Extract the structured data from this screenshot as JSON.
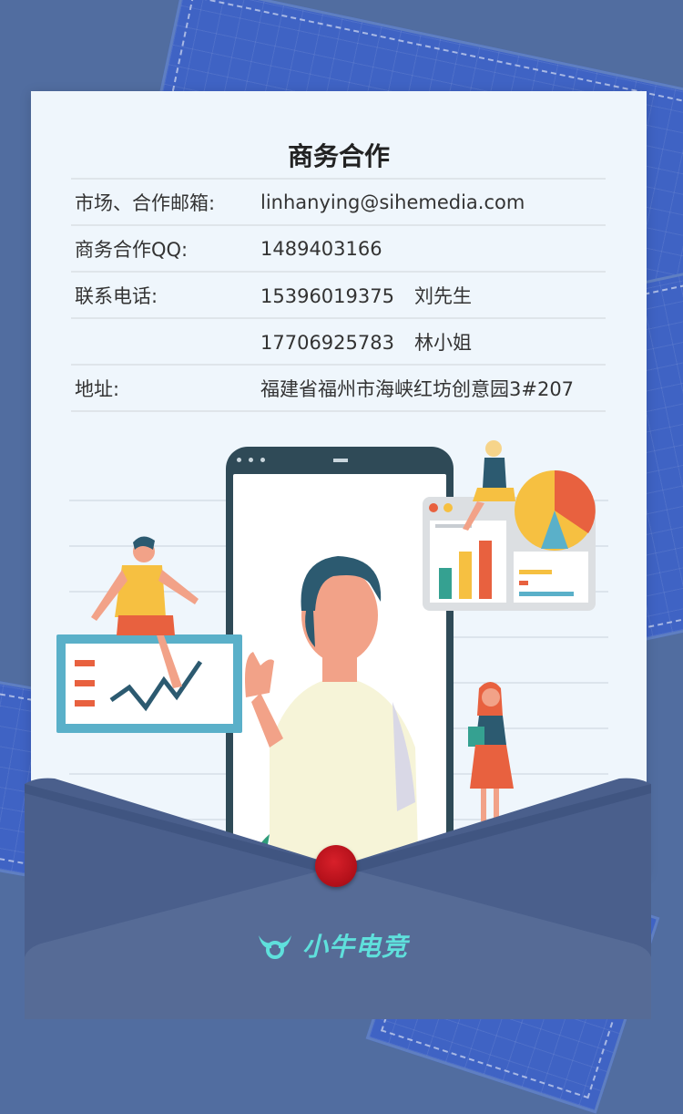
{
  "card": {
    "title": "商务合作",
    "rows": [
      {
        "label": "市场、合作邮箱:",
        "value": "linhanying@sihemedia.com"
      },
      {
        "label": "商务合作QQ:",
        "value": "1489403166"
      },
      {
        "label": "联系电话:",
        "value": "15396019375",
        "person": "刘先生"
      },
      {
        "label": "",
        "value": "17706925783",
        "person": "林小姐"
      },
      {
        "label": "地址:",
        "value": "福建省福州市海峡红坊创意园3#207"
      }
    ]
  },
  "brand": {
    "name": "小牛电竞",
    "color": "#5fe0dc"
  },
  "colors": {
    "background": "#516da0",
    "paper": "#eff6fc",
    "envelope": "#3f5684",
    "seal": "#c4141e"
  }
}
